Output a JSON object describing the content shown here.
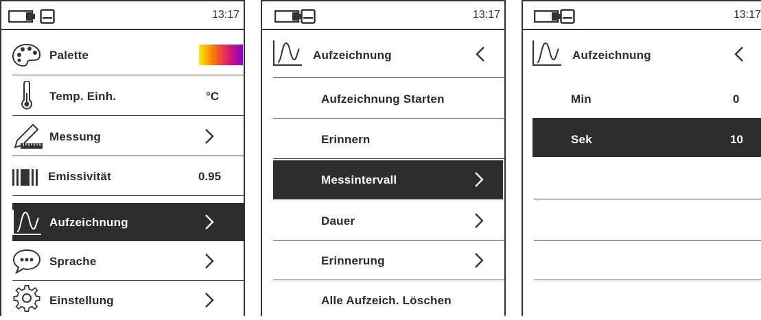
{
  "status": {
    "time": "13:17"
  },
  "panel1": {
    "items": [
      {
        "label": "Palette",
        "value": ""
      },
      {
        "label": "Temp. Einh.",
        "value": "°C"
      },
      {
        "label": "Messung",
        "value": ""
      },
      {
        "label": "Emissivität",
        "value": "0.95"
      },
      {
        "label": "Aufzeichnung",
        "value": ""
      },
      {
        "label": "Sprache",
        "value": ""
      },
      {
        "label": "Einstellung",
        "value": ""
      }
    ],
    "selected": "Aufzeichnung"
  },
  "panel2": {
    "header": "Aufzeichnung",
    "items": [
      {
        "label": "Aufzeichnung Starten"
      },
      {
        "label": "Erinnern"
      },
      {
        "label": "Messintervall"
      },
      {
        "label": "Dauer"
      },
      {
        "label": "Erinnerung"
      },
      {
        "label": "Alle Aufzeich. Löschen"
      }
    ],
    "selected": "Messintervall"
  },
  "panel3": {
    "header": "Aufzeichnung",
    "items": [
      {
        "label": "Min",
        "value": "0"
      },
      {
        "label": "Sek",
        "value": "10"
      }
    ],
    "selected": "Sek"
  },
  "colors": {
    "selected_bg": "#2d2d2d",
    "palette_gradient": [
      "#ffea00",
      "#ff8000",
      "#e0206a",
      "#8800c8"
    ]
  }
}
